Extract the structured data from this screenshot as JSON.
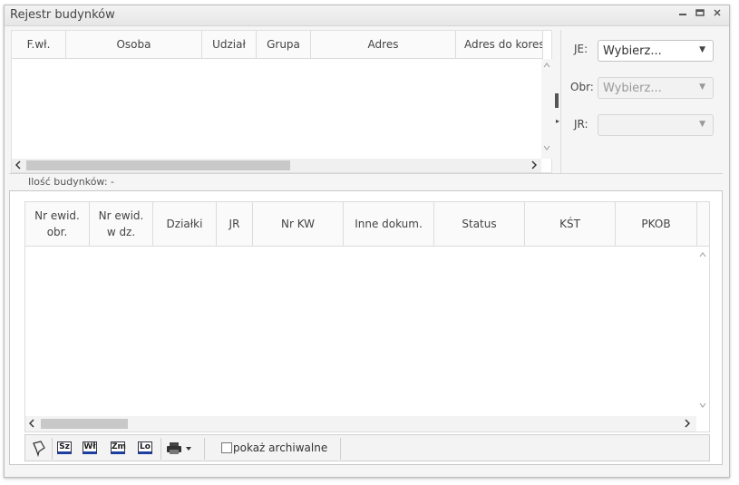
{
  "window": {
    "title": "Rejestr budynków",
    "minimize_icon": "minimize-icon",
    "maximize_icon": "maximize-icon",
    "close_icon": "close-icon"
  },
  "upper_grid": {
    "columns": [
      "F.wł.",
      "Osoba",
      "Udział",
      "Grupa",
      "Adres",
      "Adres do kores"
    ]
  },
  "filters": {
    "je": {
      "label": "JE:",
      "value": "Wybierz..."
    },
    "obr": {
      "label": "Obr:",
      "value": "Wybierz..."
    },
    "jr": {
      "label": "JR:",
      "value": ""
    }
  },
  "count_label": "Ilość budynków: -",
  "lower_grid": {
    "columns": [
      "Nr ewid.\nobr.",
      "Nr ewid.\nw dz.",
      "Działki",
      "JR",
      "Nr KW",
      "Inne dokum.",
      "Status",
      "KŚT",
      "PKOB"
    ]
  },
  "toolbar": {
    "buttons": [
      {
        "icon": "map-pin-icon"
      },
      {
        "label": "Sz",
        "icon": "sz-icon"
      },
      {
        "label": "Wł",
        "icon": "wl-icon"
      },
      {
        "label": "Zm",
        "icon": "zm-icon"
      },
      {
        "label": "Lo",
        "icon": "lo-icon"
      }
    ],
    "print_icon": "printer-icon",
    "archive_checkbox_label": "pokaż archiwalne"
  }
}
